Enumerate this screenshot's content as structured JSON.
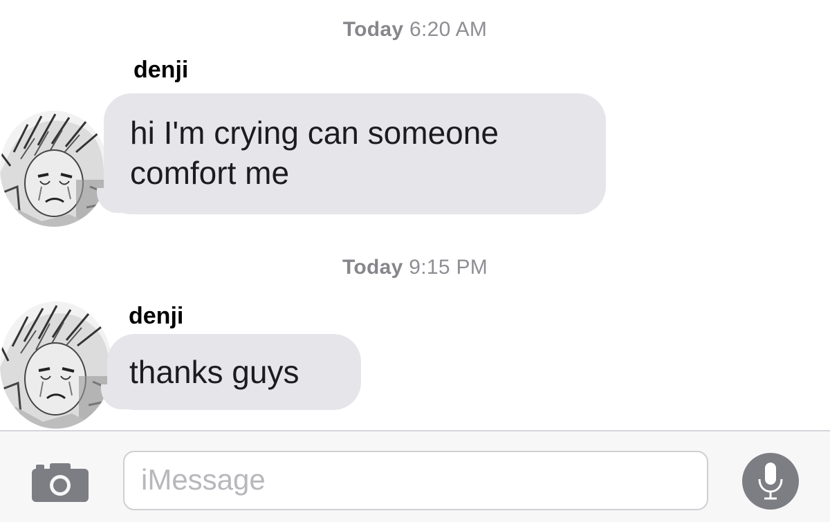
{
  "conversation": [
    {
      "timestamp_day": "Today",
      "timestamp_time": "6:20 AM",
      "sender": "denji",
      "message": "hi I'm crying can someone comfort me"
    },
    {
      "timestamp_day": "Today",
      "timestamp_time": "9:15 PM",
      "sender": "denji",
      "message": "thanks guys"
    }
  ],
  "compose": {
    "placeholder": "iMessage",
    "camera_icon": "camera-icon",
    "mic_icon": "microphone-icon"
  },
  "colors": {
    "incoming_bubble": "#e6e5ea",
    "timestamp": "#8e8e93",
    "icon_gray": "#7d7d84"
  }
}
